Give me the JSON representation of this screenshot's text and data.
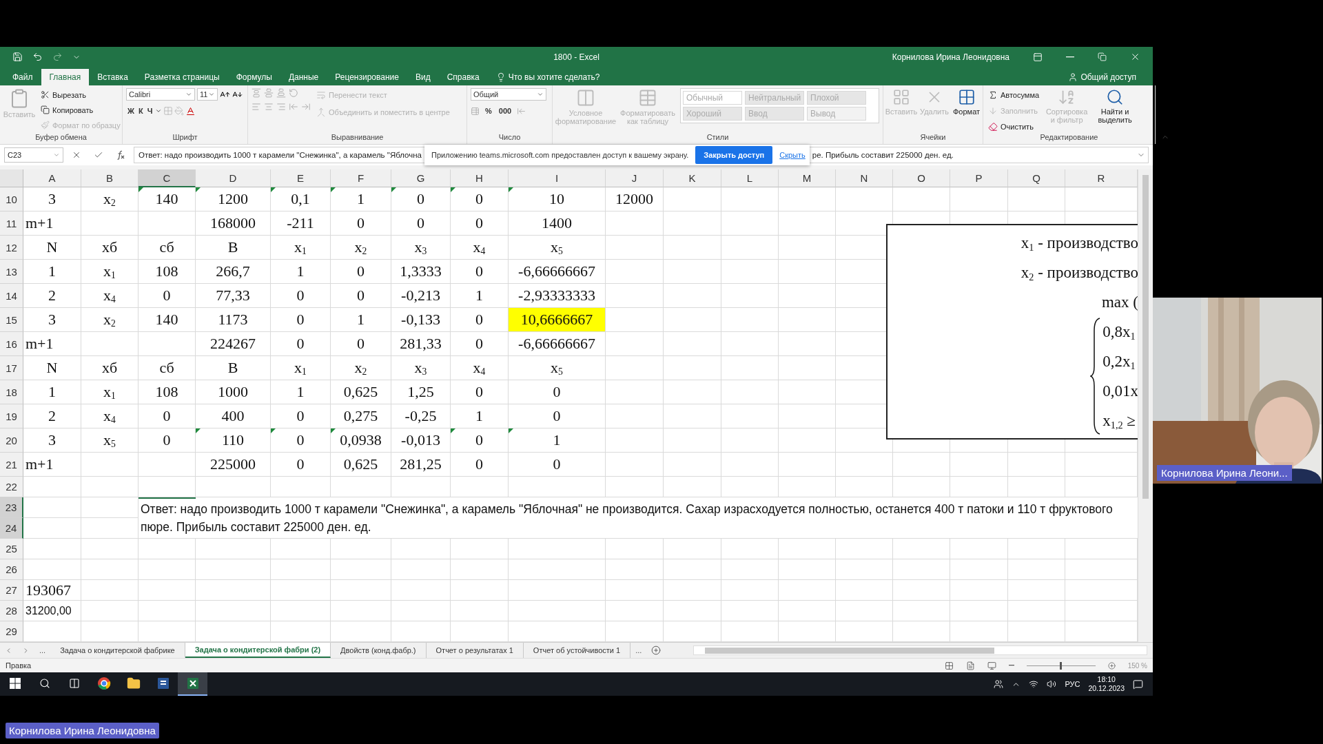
{
  "title_bar": {
    "title": "1800  -  Excel",
    "user": "Корнилова Ирина Леонидовна"
  },
  "ribbon_tabs": [
    {
      "label": "Файл",
      "selected": false
    },
    {
      "label": "Главная",
      "selected": true
    },
    {
      "label": "Вставка",
      "selected": false
    },
    {
      "label": "Разметка страницы",
      "selected": false
    },
    {
      "label": "Формулы",
      "selected": false
    },
    {
      "label": "Данные",
      "selected": false
    },
    {
      "label": "Рецензирование",
      "selected": false
    },
    {
      "label": "Вид",
      "selected": false
    },
    {
      "label": "Справка",
      "selected": false
    }
  ],
  "tell_me": "Что вы хотите сделать?",
  "share": "Общий доступ",
  "ribbon_groups": [
    {
      "kind": "clipboard",
      "label": "Буфер обмена",
      "buttons": [
        {
          "label": "Вставить",
          "disabled": true
        }
      ],
      "items": [
        {
          "label": "Вырезать",
          "disabled": false
        },
        {
          "label": "Копировать",
          "disabled": false
        },
        {
          "label": "Формат по образцу",
          "disabled": true
        }
      ]
    },
    {
      "kind": "font",
      "label": "Шрифт",
      "font": "Calibri",
      "size": "11",
      "styles": [
        "Ж",
        "К",
        "Ч"
      ]
    },
    {
      "kind": "alignment",
      "label": "Выравнивание",
      "items": [
        {
          "label": "Перенести текст",
          "disabled": true
        },
        {
          "label": "Объединить и поместить в центре",
          "disabled": true
        }
      ]
    },
    {
      "kind": "number",
      "label": "Число",
      "format": "Общий",
      "symbols": [
        "%",
        "000"
      ]
    },
    {
      "kind": "styles",
      "label": "Стили",
      "buttons": [
        {
          "label": "Условное форматирование",
          "disabled": true
        },
        {
          "label": "Форматировать как таблицу",
          "disabled": true
        }
      ],
      "cells": [
        {
          "label": "Обычный",
          "color": "#ffffff"
        },
        {
          "label": "Нейтральный",
          "color": "#e6e6e6"
        },
        {
          "label": "Плохой",
          "color": "#e6e6e6"
        },
        {
          "label": "Хороший",
          "color": "#e6e6e6"
        },
        {
          "label": "Ввод",
          "color": "#e6e6e6"
        },
        {
          "label": "Вывод",
          "color": "#f2f2f2"
        }
      ]
    },
    {
      "kind": "cells",
      "label": "Ячейки",
      "buttons": [
        {
          "label": "Вставить",
          "disabled": true
        },
        {
          "label": "Удалить",
          "disabled": true
        },
        {
          "label": "Формат",
          "disabled": false
        }
      ]
    },
    {
      "kind": "editing",
      "label": "Редактирование",
      "items": [
        {
          "label": "Автосумма",
          "disabled": false
        },
        {
          "label": "Заполнить",
          "disabled": true
        },
        {
          "label": "Очистить",
          "disabled": false
        }
      ],
      "buttons": [
        {
          "label": "Сортировка и фильтр",
          "disabled": true
        },
        {
          "label": "Найти и выделить",
          "disabled": false
        }
      ]
    }
  ],
  "formula_bar": {
    "name_box": "C23",
    "formula_start": "Ответ: надо производить 1000 т карамели \"Снежинка\", а карамель \"Яблочна",
    "formula_end": "ре. Прибыль составит 225000 ден. ед."
  },
  "share_notice": {
    "text": "Приложению teams.microsoft.com предоставлен доступ к вашему экрану.",
    "button": "Закрыть доступ",
    "link": "Скрыть"
  },
  "sheet": {
    "columns": [
      {
        "label": "A",
        "selected": false
      },
      {
        "label": "B",
        "selected": false
      },
      {
        "label": "C",
        "selected": true
      },
      {
        "label": "D",
        "selected": false
      },
      {
        "label": "E",
        "selected": false
      },
      {
        "label": "F",
        "selected": false
      },
      {
        "label": "G",
        "selected": false
      },
      {
        "label": "H",
        "selected": false
      },
      {
        "label": "I",
        "selected": false
      },
      {
        "label": "J",
        "selected": false
      },
      {
        "label": "K",
        "selected": false
      },
      {
        "label": "L",
        "selected": false
      },
      {
        "label": "M",
        "selected": false
      },
      {
        "label": "N",
        "selected": false
      },
      {
        "label": "O",
        "selected": false
      },
      {
        "label": "P",
        "selected": false
      },
      {
        "label": "Q",
        "selected": false
      },
      {
        "label": "R",
        "selected": false
      }
    ],
    "rows": [
      {
        "number": "10",
        "kind": "table",
        "selected": false,
        "cells": [
          {
            "text": "3",
            "flagged": false
          },
          {
            "text": "x$_{2}$",
            "flagged": false
          },
          {
            "text": "140",
            "flagged": true
          },
          {
            "text": "1200",
            "flagged": true
          },
          {
            "text": "0,1",
            "flagged": true
          },
          {
            "text": "1",
            "flagged": true
          },
          {
            "text": "0",
            "flagged": true
          },
          {
            "text": "0",
            "flagged": true
          },
          {
            "text": "10",
            "flagged": true
          },
          {
            "text": "12000",
            "flagged": false
          }
        ]
      },
      {
        "number": "11",
        "kind": "total",
        "selected": false,
        "cells": [
          "m+1",
          null,
          null,
          "168000",
          "-211",
          "0",
          "0",
          "0",
          "1400"
        ]
      },
      {
        "number": "12",
        "kind": "table",
        "selected": false,
        "cells": [
          "N",
          "xб",
          "сб",
          "B",
          "x$_{1}$",
          "x$_{2}$",
          "x$_{3}$",
          "x$_{4}$",
          "x$_{5}$"
        ]
      },
      {
        "number": "13",
        "kind": "table",
        "selected": false,
        "cells": [
          "1",
          "x$_{1}$",
          "108",
          "266,7",
          "1",
          "0",
          "1,3333",
          "0",
          "-6,66666667"
        ]
      },
      {
        "number": "14",
        "kind": "table",
        "selected": false,
        "cells": [
          "2",
          "x$_{4}$",
          "0",
          "77,33",
          "0",
          "0",
          "-0,213",
          "1",
          "-2,93333333"
        ]
      },
      {
        "number": "15",
        "kind": "table",
        "selected": false,
        "cells": [
          {
            "text": "3",
            "highlighted": false
          },
          {
            "text": "x$_{2}$",
            "highlighted": false
          },
          {
            "text": "140",
            "highlighted": false
          },
          {
            "text": "1173",
            "highlighted": false
          },
          {
            "text": "0",
            "highlighted": false
          },
          {
            "text": "1",
            "highlighted": false
          },
          {
            "text": "-0,133",
            "highlighted": false
          },
          {
            "text": "0",
            "highlighted": false
          },
          {
            "text": "10,6666667",
            "highlighted": true
          }
        ]
      },
      {
        "number": "16",
        "kind": "total",
        "selected": false,
        "cells": [
          "m+1",
          null,
          null,
          "224267",
          "0",
          "0",
          "281,33",
          "0",
          "-6,66666667"
        ]
      },
      {
        "number": "17",
        "kind": "table",
        "selected": false,
        "cells": [
          "N",
          "xб",
          "сб",
          "B",
          "x$_{1}$",
          "x$_{2}$",
          "x$_{3}$",
          "x$_{4}$",
          "x$_{5}$"
        ]
      },
      {
        "number": "18",
        "kind": "table",
        "selected": false,
        "cells": [
          "1",
          "x$_{1}$",
          "108",
          "1000",
          "1",
          "0,625",
          "1,25",
          "0",
          "0"
        ]
      },
      {
        "number": "19",
        "kind": "table",
        "selected": false,
        "cells": [
          "2",
          "x$_{4}$",
          "0",
          "400",
          "0",
          "0,275",
          "-0,25",
          "1",
          "0"
        ]
      },
      {
        "number": "20",
        "kind": "table",
        "selected": false,
        "cells": [
          {
            "text": "3",
            "flagged": false
          },
          {
            "text": "x$_{5}$",
            "flagged": false
          },
          {
            "text": "0",
            "flagged": false
          },
          {
            "text": "110",
            "flagged": true
          },
          {
            "text": "0",
            "flagged": true
          },
          {
            "text": "0,0938",
            "flagged": true
          },
          {
            "text": "-0,013",
            "flagged": false
          },
          {
            "text": "0",
            "flagged": true
          },
          {
            "text": "1",
            "flagged": true
          }
        ]
      },
      {
        "number": "21",
        "kind": "total",
        "selected": false,
        "cells": [
          "m+1",
          null,
          null,
          "225000",
          "0",
          "0,625",
          "281,25",
          "0",
          "0"
        ]
      },
      {
        "number": "22",
        "kind": "blank",
        "selected": false
      },
      {
        "number": "23",
        "kind": "note",
        "selected": true,
        "note": "Ответ: надо производить 1000 т карамели \"Снежинка\", а карамель \"Яблочная\" не производится. Сахар израсходуется полностью, останется 400 т патоки и 110 т фруктового пюре. Прибыль составит 225000 ден. ед."
      },
      {
        "number": "24",
        "kind": "blank",
        "selected": true
      },
      {
        "number": "25",
        "kind": "blank",
        "selected": false
      },
      {
        "number": "26",
        "kind": "blank",
        "selected": false
      },
      {
        "number": "27",
        "kind": "value",
        "selected": false,
        "cells": [
          "193067"
        ]
      },
      {
        "number": "28",
        "kind": "calc",
        "selected": false,
        "cells": [
          "31200,00"
        ]
      },
      {
        "number": "29",
        "kind": "blank",
        "selected": false
      }
    ],
    "text_box": {
      "lines": [
        "x$_{1}$ - производство",
        "x$_{2}$ - производство",
        "max ("
      ],
      "system": [
        "0,8x$_{1}$",
        "0,2x$_{1}$",
        "0,01x",
        "x$_{1,2}$ ≥"
      ]
    }
  },
  "sheet_tabs": [
    {
      "label": "Задача о кондитерской фабрике",
      "selected": false
    },
    {
      "label": "Задача о кондитерской фабри (2)",
      "selected": true
    },
    {
      "label": "Двойств (конд.фабр.)",
      "selected": false
    },
    {
      "label": "Отчет о результатах 1",
      "selected": false
    },
    {
      "label": "Отчет об устойчивости 1",
      "selected": false
    }
  ],
  "sheet_nav": {
    "more_left": "...",
    "more_right": "..."
  },
  "status_bar": {
    "mode": "Правка",
    "zoom": "150 %",
    "zoom_slider": {
      "level": 0.5
    }
  },
  "taskbar": {
    "apps": [
      {
        "kind": "chrome",
        "active": false
      },
      {
        "kind": "folder",
        "active": false
      },
      {
        "kind": "word",
        "active": false
      },
      {
        "kind": "excel",
        "active": true
      }
    ],
    "language": "РУС",
    "time": "18:10",
    "date": "20.12.2023"
  },
  "video_tile": {
    "name": "Корнилова Ирина Леони..."
  },
  "presenter_label": "Корнилова Ирина Леонидовна"
}
